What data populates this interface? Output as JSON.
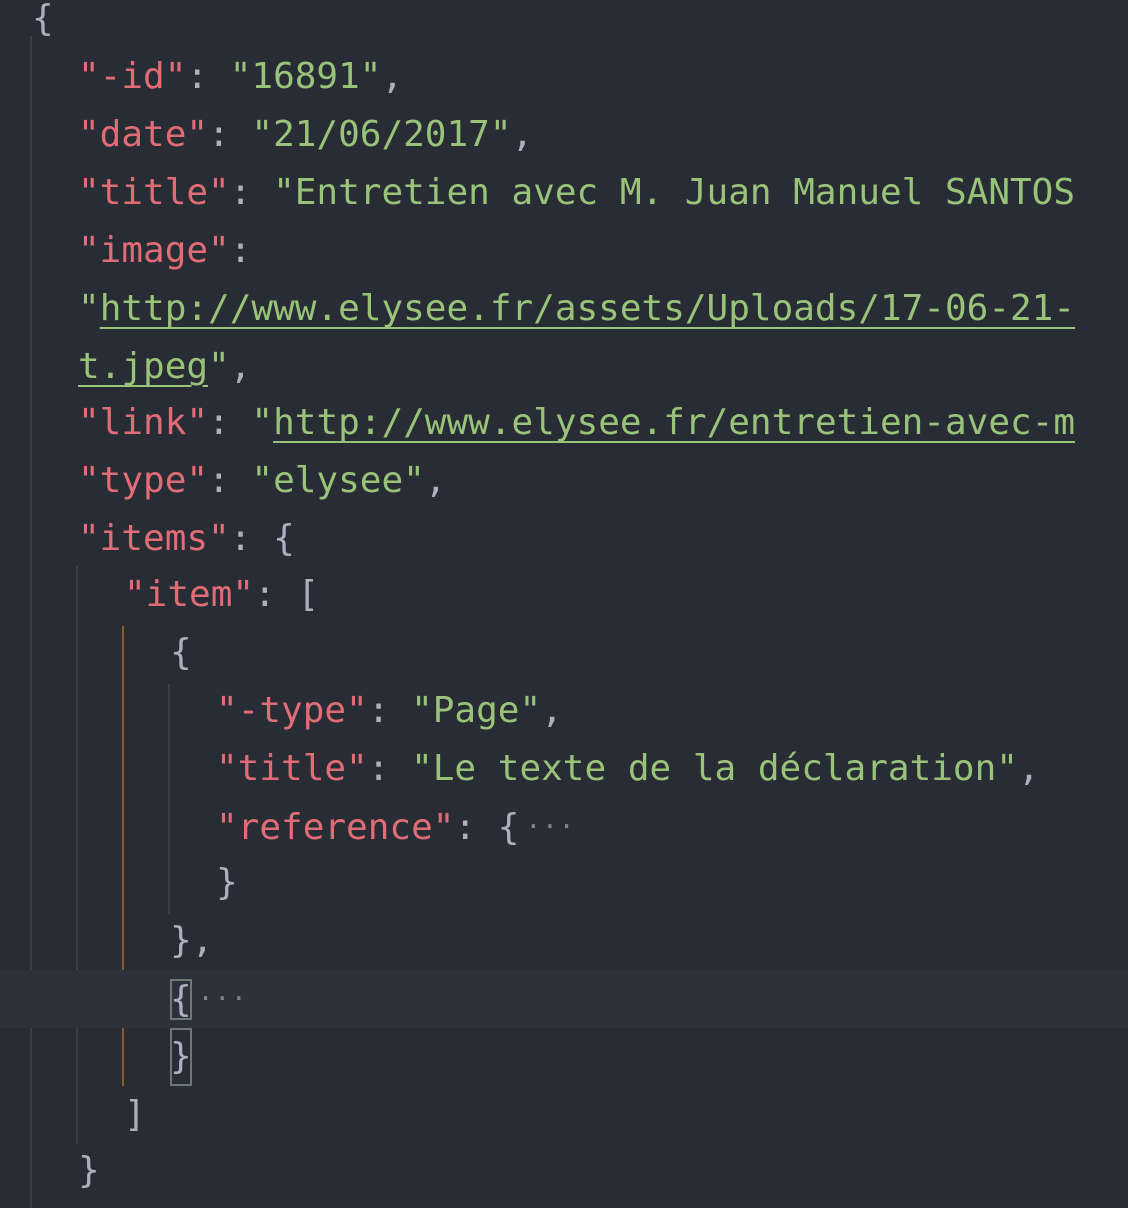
{
  "editor": {
    "lines": {
      "l1_open": "{",
      "id_key": "\"-id\"",
      "id_val": "\"16891\"",
      "date_key": "\"date\"",
      "date_val": "\"21/06/2017\"",
      "title_key": "\"title\"",
      "title_val": "\"Entretien avec M. Juan Manuel SANTOS",
      "image_key": "\"image\"",
      "image_q": "\"",
      "image_url_a": "http://www.elysee.fr/assets/Uploads/17-06-21-",
      "image_url_b": "t.jpeg",
      "image_q_end": "\"",
      "link_key": "\"link\"",
      "link_q": "\"",
      "link_url": "http://www.elysee.fr/entretien-avec-m",
      "type_key": "\"type\"",
      "type_val": "\"elysee\"",
      "items_key": "\"items\"",
      "item_key": "\"item\"",
      "sub_type_key": "\"-type\"",
      "sub_type_val": "\"Page\"",
      "sub_title_key": "\"title\"",
      "sub_title_val": "\"Le texte de la déclaration\"",
      "reference_key": "\"reference\"",
      "ellipsis": "···"
    }
  }
}
